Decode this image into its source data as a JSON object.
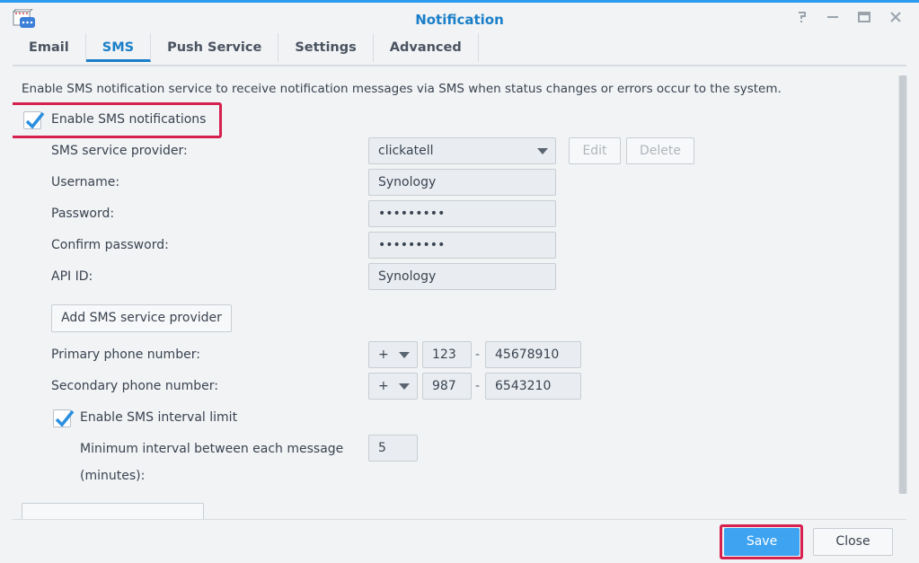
{
  "window": {
    "title": "Notification"
  },
  "tabs": [
    {
      "label": "Email"
    },
    {
      "label": "SMS"
    },
    {
      "label": "Push Service"
    },
    {
      "label": "Settings"
    },
    {
      "label": "Advanced"
    }
  ],
  "sms": {
    "description": "Enable SMS notification service to receive notification messages via SMS when status changes or errors occur to the system.",
    "enable_label": "Enable SMS notifications",
    "enable_checked": true,
    "provider_label": "SMS service provider:",
    "provider_value": "clickatell",
    "edit_button": "Edit",
    "delete_button": "Delete",
    "username_label": "Username:",
    "username_value": "Synology",
    "password_label": "Password:",
    "password_value": "•••••••••",
    "confirm_label": "Confirm password:",
    "confirm_value": "•••••••••",
    "apiid_label": "API ID:",
    "apiid_value": "Synology",
    "add_provider_button": "Add SMS service provider",
    "primary_label": "Primary phone number:",
    "primary_prefix": "+",
    "primary_code": "123",
    "primary_dash": "-",
    "primary_number": "45678910",
    "secondary_label": "Secondary phone number:",
    "secondary_prefix": "+",
    "secondary_code": "987",
    "secondary_dash": "-",
    "secondary_number": "6543210",
    "interval_label": "Enable SMS interval limit",
    "interval_checked": true,
    "min_interval_label_1": "Minimum interval between each message",
    "min_interval_label_2": "(minutes):",
    "min_interval_value": "5"
  },
  "footer": {
    "save_label": "Save",
    "close_label": "Close"
  },
  "colors": {
    "accent": "#1a7fc8",
    "highlight": "#d6204e",
    "save_button": "#3ea3f0"
  },
  "icons": [
    "app-icon",
    "help-icon",
    "minimize-icon",
    "maximize-icon",
    "close-icon",
    "checkmark-icon",
    "dropdown-arrow-icon"
  ]
}
